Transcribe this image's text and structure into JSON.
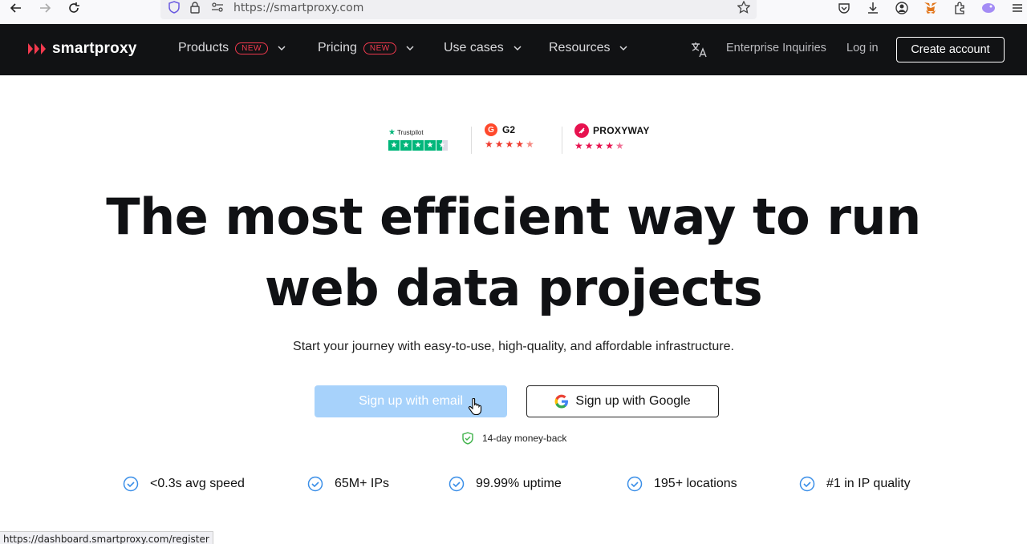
{
  "browser": {
    "url": "https://smartproxy.com",
    "status_url": "https://dashboard.smartproxy.com/register"
  },
  "nav": {
    "logo_text": "smartproxy",
    "items": [
      {
        "label": "Products",
        "badge": "NEW"
      },
      {
        "label": "Pricing",
        "badge": "NEW"
      },
      {
        "label": "Use cases"
      },
      {
        "label": "Resources"
      }
    ],
    "enterprise_label": "Enterprise Inquiries",
    "login_label": "Log in",
    "create_account_label": "Create account"
  },
  "ratings": {
    "trustpilot_label": "Trustpilot",
    "g2_label": "G2",
    "proxyway_label": "PROXYWAY"
  },
  "hero": {
    "title_line1": "The most efficient way to run",
    "title_line2": "web data projects",
    "subtitle": "Start your journey with easy-to-use, high-quality, and affordable infrastructure.",
    "email_button": "Sign up with email",
    "google_button": "Sign up with Google",
    "moneyback": "14-day money-back"
  },
  "features": [
    "<0.3s avg speed",
    "65M+ IPs",
    "99.99% uptime",
    "195+ locations",
    "#1 in IP quality"
  ],
  "colors": {
    "brand_red": "#f23a4e",
    "nav_bg": "#111214",
    "email_button_bg": "#a7d2fb",
    "check_blue": "#3b8fe8",
    "shield_green": "#3fb24a"
  }
}
